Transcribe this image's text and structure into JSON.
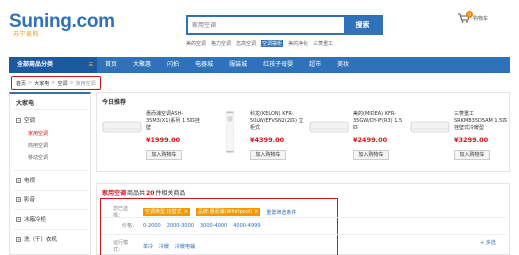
{
  "header": {
    "logo": "Suning.com",
    "logo_sub": "苏宁易购",
    "search": {
      "placeholder": "家用空调",
      "button": "搜索"
    },
    "hot_words": [
      "美的空调",
      "格力空调",
      "志高空调",
      "空调摆柜",
      "美的净化",
      "三菱重工"
    ],
    "hot_highlight_index": 3,
    "cart": {
      "label": "购物车",
      "count": "0"
    }
  },
  "nav": {
    "all_categories": "全部商品分类",
    "items": [
      "首页",
      "大聚惠",
      "闪拍",
      "电器城",
      "服装城",
      "红孩子母婴",
      "超市",
      "美妆"
    ]
  },
  "breadcrumb": [
    "首页",
    "大家电",
    "空调",
    "家用空调"
  ],
  "sidebar": {
    "title": "大家电",
    "categories": [
      {
        "label": "空调",
        "icon": "minus",
        "subs": [
          "家用空调",
          "商用空调",
          "移动空调"
        ]
      },
      {
        "label": "电视",
        "icon": "plus"
      },
      {
        "label": "影音",
        "icon": "plus"
      },
      {
        "label": "冰箱冷柜",
        "icon": "plus"
      },
      {
        "label": "洗（干）衣机",
        "icon": "plus"
      }
    ]
  },
  "today": {
    "title": "今日推荐",
    "products": [
      {
        "name": "惠而浦空调ASH-35M3(X1)系列 1.5匹挂壁",
        "price": "¥1999.00",
        "button": "加入购物车"
      },
      {
        "name": "科龙(KELON) KFR-50LW/EFVSN2(2匹) 立柜式",
        "price": "¥4399.00",
        "button": "加入购物车"
      },
      {
        "name": "美的(MIDEA) KFR-35GW/DY-IF(R3) 1.5匹",
        "price": "¥2499.00",
        "button": "加入购物车"
      },
      {
        "name": "三菱重工 SRKMB35D5AM 1.5匹 挂壁式冷暖型",
        "price": "¥3299.00",
        "button": "加入购物车"
      }
    ]
  },
  "filter": {
    "category": "家用空调",
    "middle": "商品共",
    "count": "20",
    "suffix": "件相关商品",
    "rows": [
      {
        "label": "您已选择：",
        "tags": [
          "空调类型:挂壁式",
          "品牌:惠而浦(Whirlpool)"
        ],
        "reset": "重置筛选条件"
      },
      {
        "label": "价格：",
        "values": [
          "0-2000",
          "2000-3000",
          "3000-4000",
          "4000-4999"
        ]
      },
      {
        "label": "运行模式：",
        "values": [
          "单冷",
          "冷暖",
          "冷暖电辅"
        ]
      }
    ],
    "more": "+ 多选"
  },
  "colors": {
    "brand_blue": "#2f72b9",
    "price_red": "#d7131b",
    "tag_orange": "#f39800"
  }
}
